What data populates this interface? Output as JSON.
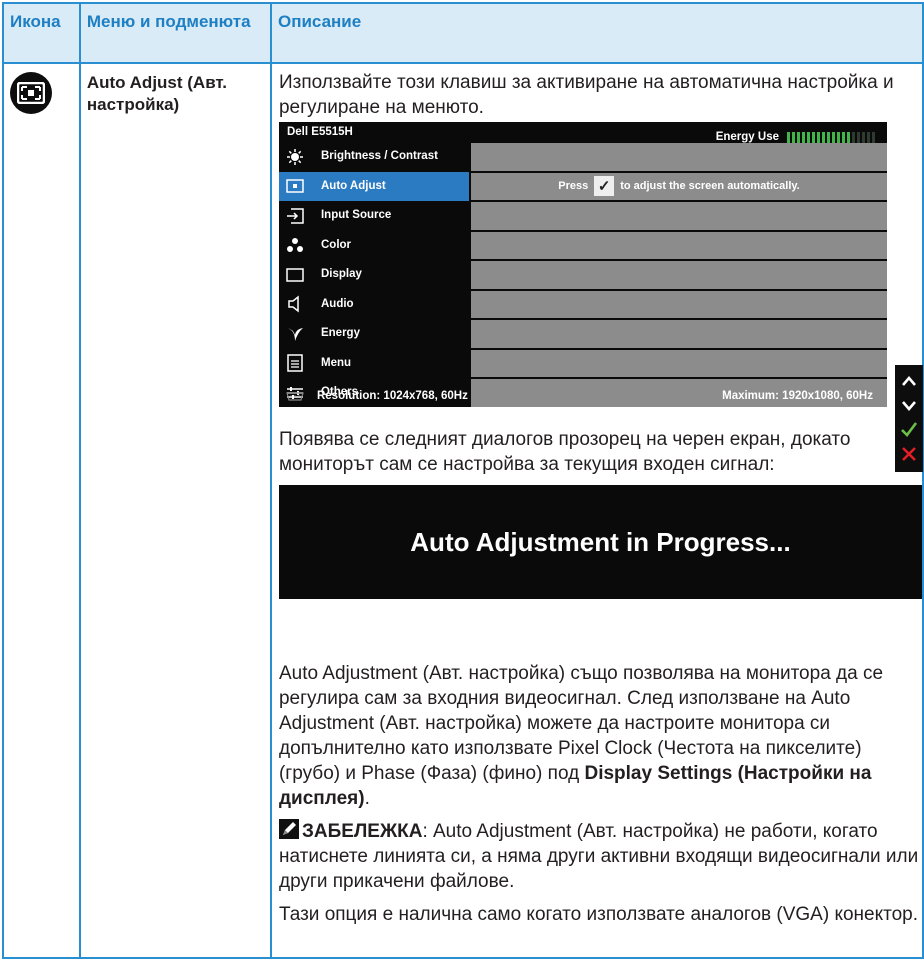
{
  "headers": {
    "icon": "Икона",
    "menu": "Меню и подменюта",
    "desc": "Описание"
  },
  "row": {
    "icon_name": "auto-adjust-icon",
    "menu_label": "Auto Adjust (Авт. настройка)",
    "intro": "Използвайте този клавиш за активиране на автоматична настройка и регулиране на менюто."
  },
  "osd": {
    "model": "Dell E5515H",
    "energy_label": "Energy Use",
    "energy_level": 0.7,
    "items": [
      {
        "icon": "brightness-icon",
        "label": "Brightness / Contrast"
      },
      {
        "icon": "auto-adjust-icon",
        "label": "Auto Adjust"
      },
      {
        "icon": "input-source-icon",
        "label": "Input Source"
      },
      {
        "icon": "color-icon",
        "label": "Color"
      },
      {
        "icon": "display-icon",
        "label": "Display"
      },
      {
        "icon": "audio-icon",
        "label": "Audio"
      },
      {
        "icon": "energy-icon",
        "label": "Energy"
      },
      {
        "icon": "menu-icon",
        "label": "Menu"
      },
      {
        "icon": "others-icon",
        "label": "Others"
      }
    ],
    "active_index": 1,
    "hint_press": "Press",
    "hint_rest": "to adjust the screen automatically.",
    "resolution": "Resolution: 1024x768, 60Hz",
    "maximum": "Maximum: 1920x1080, 60Hz",
    "side_buttons": [
      "up-arrow-icon",
      "down-arrow-icon",
      "check-icon",
      "close-icon"
    ],
    "side_colors": {
      "arrows": "#ffffff",
      "check": "#6cc04a",
      "close": "#e31e24"
    }
  },
  "para2": "Появява се следният диалогов прозорец на черен екран, докато мониторът сам се настройва за текущия входен сигнал:",
  "progress_text": "Auto Adjustment in Progress...",
  "para3_a": "Auto Adjustment (Авт. настройка) също позволява на монитора да се регулира сам за входния видеосигнал. След използване на Auto Adjustment (Авт. настройка) можете да настроите монитора си допълнително като използвате Pixel Clock (Честота на пикселите) (грубо) и Phase (Фаза) (фино) под ",
  "para3_bold": "Display Settings (Настройки на дисплея)",
  "para3_end": ".",
  "note_label": "ЗАБЕЛЕЖКА",
  "note_text": ": Auto Adjustment (Авт. настройка) не работи, когато натиснете линията си, а няма други активни входящи видеосигнали или други прикачени файлове.",
  "para5": "Тази опция е налична само когато използвате аналогов (VGA) конектор.",
  "colors": {
    "border": "#2a8fd0",
    "header_bg": "#d9ebf7",
    "header_text": "#1e7fc3",
    "osd_active": "#2b7bc2",
    "energy_bar": "#43b649"
  }
}
